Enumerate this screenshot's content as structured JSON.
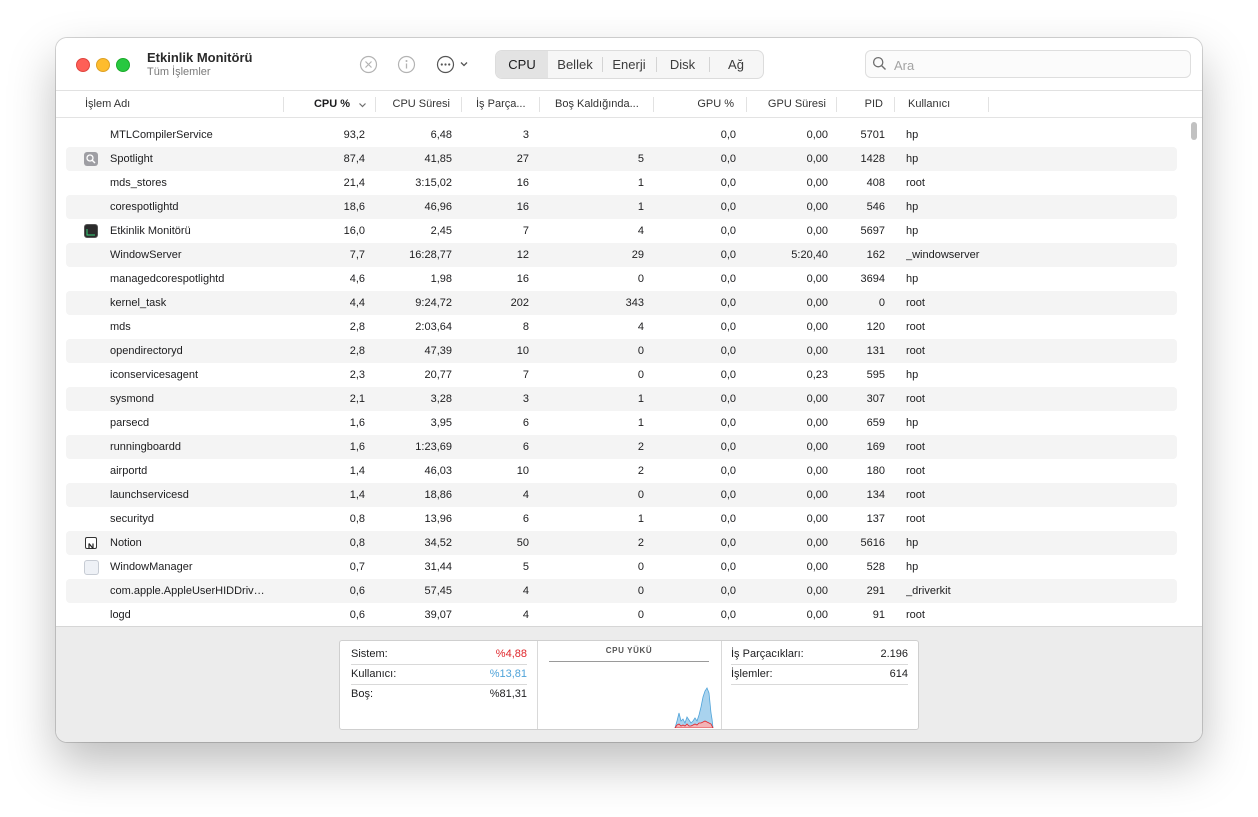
{
  "window": {
    "title": "Etkinlik Monitörü",
    "subtitle": "Tüm İşlemler"
  },
  "toolbar": {
    "stop_icon": "x-circle-icon",
    "info_icon": "info-icon",
    "more_icon": "ellipsis-circle-icon",
    "tabs": [
      {
        "label": "CPU",
        "active": true
      },
      {
        "label": "Bellek",
        "active": false
      },
      {
        "label": "Enerji",
        "active": false
      },
      {
        "label": "Disk",
        "active": false
      },
      {
        "label": "Ağ",
        "active": false
      }
    ],
    "search_placeholder": "Ara"
  },
  "table": {
    "columns": [
      "İşlem Adı",
      "CPU %",
      "CPU Süresi",
      "İş Parça...",
      "Boş Kaldığında...",
      "GPU %",
      "GPU Süresi",
      "PID",
      "Kullanıcı"
    ],
    "sorted_column": "CPU %",
    "rows": [
      {
        "name": "MTLCompilerService",
        "icon": "",
        "cpu": "93,2",
        "time": "6,48",
        "threads": "3",
        "idle": "",
        "gpu": "0,0",
        "gpu_time": "0,00",
        "pid": "5701",
        "user": "hp"
      },
      {
        "name": "Spotlight",
        "icon": "spotlight-icon",
        "cpu": "87,4",
        "time": "41,85",
        "threads": "27",
        "idle": "5",
        "gpu": "0,0",
        "gpu_time": "0,00",
        "pid": "1428",
        "user": "hp"
      },
      {
        "name": "mds_stores",
        "icon": "",
        "cpu": "21,4",
        "time": "3:15,02",
        "threads": "16",
        "idle": "1",
        "gpu": "0,0",
        "gpu_time": "0,00",
        "pid": "408",
        "user": "root"
      },
      {
        "name": "corespotlightd",
        "icon": "",
        "cpu": "18,6",
        "time": "46,96",
        "threads": "16",
        "idle": "1",
        "gpu": "0,0",
        "gpu_time": "0,00",
        "pid": "546",
        "user": "hp"
      },
      {
        "name": "Etkinlik Monitörü",
        "icon": "activity-monitor-icon",
        "cpu": "16,0",
        "time": "2,45",
        "threads": "7",
        "idle": "4",
        "gpu": "0,0",
        "gpu_time": "0,00",
        "pid": "5697",
        "user": "hp"
      },
      {
        "name": "WindowServer",
        "icon": "",
        "cpu": "7,7",
        "time": "16:28,77",
        "threads": "12",
        "idle": "29",
        "gpu": "0,0",
        "gpu_time": "5:20,40",
        "pid": "162",
        "user": "_windowserver"
      },
      {
        "name": "managedcorespotlightd",
        "icon": "",
        "cpu": "4,6",
        "time": "1,98",
        "threads": "16",
        "idle": "0",
        "gpu": "0,0",
        "gpu_time": "0,00",
        "pid": "3694",
        "user": "hp"
      },
      {
        "name": "kernel_task",
        "icon": "",
        "cpu": "4,4",
        "time": "9:24,72",
        "threads": "202",
        "idle": "343",
        "gpu": "0,0",
        "gpu_time": "0,00",
        "pid": "0",
        "user": "root"
      },
      {
        "name": "mds",
        "icon": "",
        "cpu": "2,8",
        "time": "2:03,64",
        "threads": "8",
        "idle": "4",
        "gpu": "0,0",
        "gpu_time": "0,00",
        "pid": "120",
        "user": "root"
      },
      {
        "name": "opendirectoryd",
        "icon": "",
        "cpu": "2,8",
        "time": "47,39",
        "threads": "10",
        "idle": "0",
        "gpu": "0,0",
        "gpu_time": "0,00",
        "pid": "131",
        "user": "root"
      },
      {
        "name": "iconservicesagent",
        "icon": "",
        "cpu": "2,3",
        "time": "20,77",
        "threads": "7",
        "idle": "0",
        "gpu": "0,0",
        "gpu_time": "0,23",
        "pid": "595",
        "user": "hp"
      },
      {
        "name": "sysmond",
        "icon": "",
        "cpu": "2,1",
        "time": "3,28",
        "threads": "3",
        "idle": "1",
        "gpu": "0,0",
        "gpu_time": "0,00",
        "pid": "307",
        "user": "root"
      },
      {
        "name": "parsecd",
        "icon": "",
        "cpu": "1,6",
        "time": "3,95",
        "threads": "6",
        "idle": "1",
        "gpu": "0,0",
        "gpu_time": "0,00",
        "pid": "659",
        "user": "hp"
      },
      {
        "name": "runningboardd",
        "icon": "",
        "cpu": "1,6",
        "time": "1:23,69",
        "threads": "6",
        "idle": "2",
        "gpu": "0,0",
        "gpu_time": "0,00",
        "pid": "169",
        "user": "root"
      },
      {
        "name": "airportd",
        "icon": "",
        "cpu": "1,4",
        "time": "46,03",
        "threads": "10",
        "idle": "2",
        "gpu": "0,0",
        "gpu_time": "0,00",
        "pid": "180",
        "user": "root"
      },
      {
        "name": "launchservicesd",
        "icon": "",
        "cpu": "1,4",
        "time": "18,86",
        "threads": "4",
        "idle": "0",
        "gpu": "0,0",
        "gpu_time": "0,00",
        "pid": "134",
        "user": "root"
      },
      {
        "name": "securityd",
        "icon": "",
        "cpu": "0,8",
        "time": "13,96",
        "threads": "6",
        "idle": "1",
        "gpu": "0,0",
        "gpu_time": "0,00",
        "pid": "137",
        "user": "root"
      },
      {
        "name": "Notion",
        "icon": "notion-icon",
        "cpu": "0,8",
        "time": "34,52",
        "threads": "50",
        "idle": "2",
        "gpu": "0,0",
        "gpu_time": "0,00",
        "pid": "5616",
        "user": "hp"
      },
      {
        "name": "WindowManager",
        "icon": "window-manager-icon",
        "cpu": "0,7",
        "time": "31,44",
        "threads": "5",
        "idle": "0",
        "gpu": "0,0",
        "gpu_time": "0,00",
        "pid": "528",
        "user": "hp"
      },
      {
        "name": "com.apple.AppleUserHIDDriv…",
        "icon": "",
        "cpu": "0,6",
        "time": "57,45",
        "threads": "4",
        "idle": "0",
        "gpu": "0,0",
        "gpu_time": "0,00",
        "pid": "291",
        "user": "_driverkit"
      },
      {
        "name": "logd",
        "icon": "",
        "cpu": "0,6",
        "time": "39,07",
        "threads": "4",
        "idle": "0",
        "gpu": "0,0",
        "gpu_time": "0,00",
        "pid": "91",
        "user": "root"
      }
    ]
  },
  "footer": {
    "system_label": "Sistem:",
    "system_value": "%4,88",
    "user_label": "Kullanıcı:",
    "user_value": "%13,81",
    "idle_label": "Boş:",
    "idle_value": "%81,31",
    "graph_title": "CPU YÜKÜ",
    "threads_label": "İş Parçacıkları:",
    "threads_value": "2.196",
    "processes_label": "İşlemler:",
    "processes_value": "614",
    "colors": {
      "system": "#e0262b",
      "user": "#4fa3d9",
      "system_fill": "#f3b3b6",
      "user_fill": "#a9d3ee"
    }
  }
}
